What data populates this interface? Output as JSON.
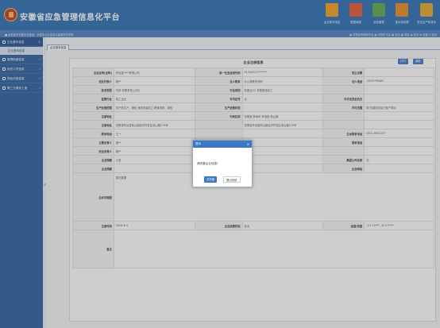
{
  "header": {
    "title": "安徽省应急管理信息化平台",
    "nav": [
      {
        "label": "企业基本信息",
        "color": "#f0a020"
      },
      {
        "label": "数据填报",
        "color": "#e2563b"
      },
      {
        "label": "信息管理",
        "color": "#5aa84a"
      },
      {
        "label": "重大危险源",
        "color": "#e88a24"
      },
      {
        "label": "安全生产标准化",
        "color": "#e4a72c"
      }
    ]
  },
  "subbar": {
    "notice": "■ 因信息不完整无法使用，请核实企业信息后重新提交审核",
    "links": "▣ 可视化驾驶舱平台  ▣ 可视化平台  ▣ 待办  ▣ 消息  ◉ 首页  ✿ 设置  ⏻ 退出"
  },
  "sidebar": {
    "items": [
      {
        "label": "企业基本信息",
        "arrow": "∨"
      },
      {
        "label": "企业基本信息",
        "sub": true
      },
      {
        "label": "管理制度信息",
        "arrow": "›"
      },
      {
        "label": "相关人员信息",
        "arrow": "›"
      },
      {
        "label": "物品设施信息",
        "arrow": "›"
      },
      {
        "label": "第三方服务上报",
        "arrow": "›"
      }
    ],
    "collapse": "«"
  },
  "tab": {
    "label": "企业基本信息"
  },
  "panel": {
    "title": "企业注册信息",
    "btn_print": "打印",
    "btn_edit": "编辑",
    "rows": [
      [
        "企业名称(全称)",
        "怀远县****有限公司",
        "统一社会信用代码",
        "91340321*******",
        "成立日期",
        ""
      ],
      [
        "法定代表人",
        "姚**",
        "法人联系",
        "办公室联系号码",
        "法人电话",
        "1525***6065"
      ],
      [
        "经济类型",
        "内资  有限责任(公司)",
        "行业类别",
        "制造业(C)  农副食品加工",
        "",
        ""
      ],
      [
        "监管行业",
        "轻工企业",
        "许可证号",
        "无",
        "许可证发证机关",
        ""
      ],
      [
        "生产经营范围",
        "农产品生产、销售;食品初级加工;粮食收购、销售",
        "生产经营状态",
        "",
        "许可范围",
        "现 在建项目及已投产项目"
      ],
      [
        "注册地址",
        "",
        "行政区划",
        "安徽省  蚌埠市  怀远县  荆山镇",
        "",
        ""
      ],
      [
        "注册地址",
        "安徽省怀远县荆山镇经济开发区涂山路179号",
        "",
        "安徽省怀远县荆山镇经济开发区涂山路179号",
        "",
        ""
      ],
      [
        "联系电话",
        "王  *",
        "",
        "",
        "企业联系电话",
        "0552-8051227"
      ],
      [
        "主要负责人",
        "姚**",
        "",
        "0527",
        "联系电话",
        ""
      ],
      [
        "安全负责人",
        "姚**",
        "",
        "0527",
        "",
        ""
      ],
      [
        "企业规模",
        "小型",
        "上级主管单位",
        "无",
        "集团公司名称",
        "无"
      ],
      [
        "企业规模",
        "",
        "企业网址",
        "",
        "企业网站",
        ""
      ],
      [
        "企业平面图",
        "暂无数据",
        "",
        "",
        "",
        ""
      ],
      [
        "注册时间",
        "2018-6-4",
        "企业经营状态",
        "营业",
        "经度/纬度",
        "117.19***, 32.97****"
      ],
      [
        "备注",
        "",
        "",
        "",
        "",
        ""
      ]
    ]
  },
  "dialog": {
    "title": "提示",
    "close": "×",
    "message": "请完善企业信息！",
    "ok": "去完善",
    "cancel": "退出系统"
  }
}
